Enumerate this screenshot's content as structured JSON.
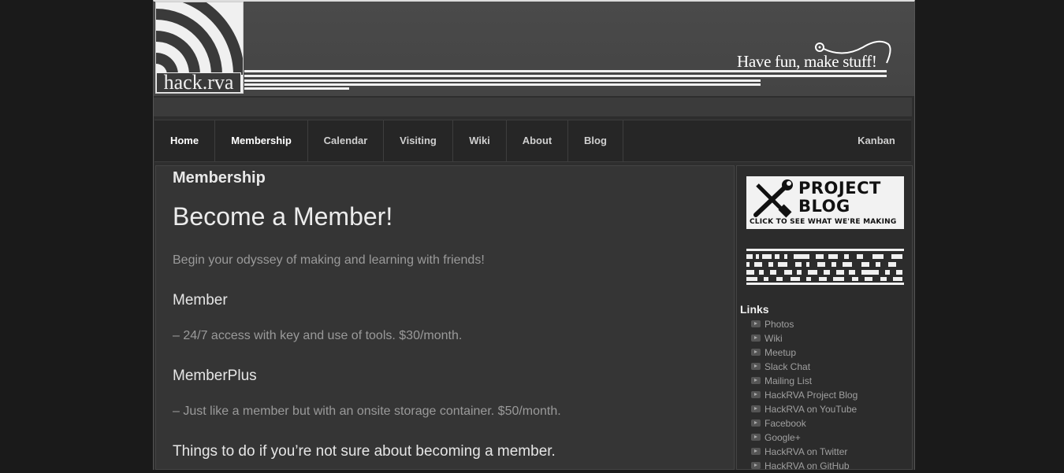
{
  "logo": {
    "text": "hack.rva"
  },
  "header": {
    "tagline": "Have fun, make stuff!"
  },
  "nav": {
    "items": [
      {
        "label": "Home"
      },
      {
        "label": "Membership"
      },
      {
        "label": "Calendar"
      },
      {
        "label": "Visiting"
      },
      {
        "label": "Wiki"
      },
      {
        "label": "About"
      },
      {
        "label": "Blog"
      }
    ],
    "right_item": {
      "label": "Kanban"
    },
    "active": "Membership"
  },
  "main": {
    "page_heading": "Membership",
    "title": "Become a Member!",
    "intro": "Begin your odyssey of making and learning with friends!",
    "sections": [
      {
        "heading": "Member",
        "text": "– 24/7 access with key and use of tools. $30/month."
      },
      {
        "heading": "MemberPlus",
        "text": "– Just like a member but with an onsite storage container. $50/month."
      }
    ],
    "subheading": "Things to do if you’re not sure about becoming a member."
  },
  "sidebar": {
    "project_blog": {
      "title_line1": "PROJECT",
      "title_line2": "BLOG",
      "subtitle": "CLICK TO SEE WHAT WE'RE MAKING"
    },
    "links_title": "Links",
    "links": [
      "Photos",
      "Wiki",
      "Meetup",
      "Slack Chat",
      "Mailing List",
      "HackRVA Project Blog",
      "HackRVA on YouTube",
      "Facebook",
      "Google+",
      "HackRVA on Twitter",
      "HackRVA on GitHub"
    ]
  },
  "colors": {
    "background": "#1a1a1a",
    "panel": "#353535",
    "nav": "#262626",
    "link": "#a0a0a0"
  },
  "icons": [
    "logo-rings-icon",
    "wrench-screwdriver-icon",
    "link-bullet-icon",
    "pixel-banner-icon"
  ]
}
